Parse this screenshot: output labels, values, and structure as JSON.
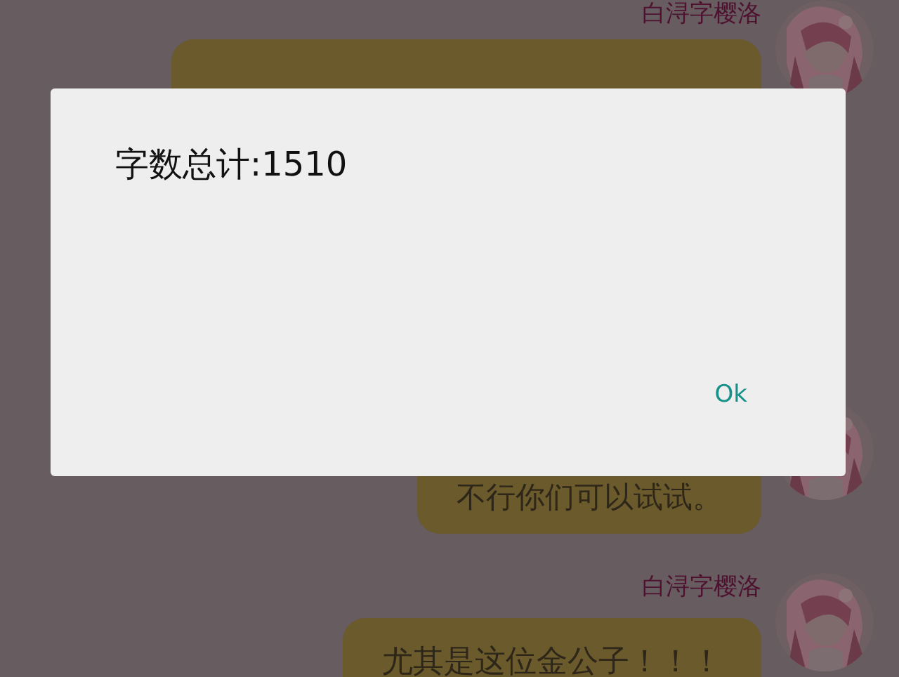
{
  "messages": [
    {
      "sender": "白浔字樱洛"
    },
    {
      "text": "不行你们可以试试。"
    },
    {
      "sender": "白浔字樱洛",
      "text": "尤其是这位金公子！！！"
    }
  ],
  "dialog": {
    "message": "字数总计:1510",
    "button": "Ok"
  }
}
